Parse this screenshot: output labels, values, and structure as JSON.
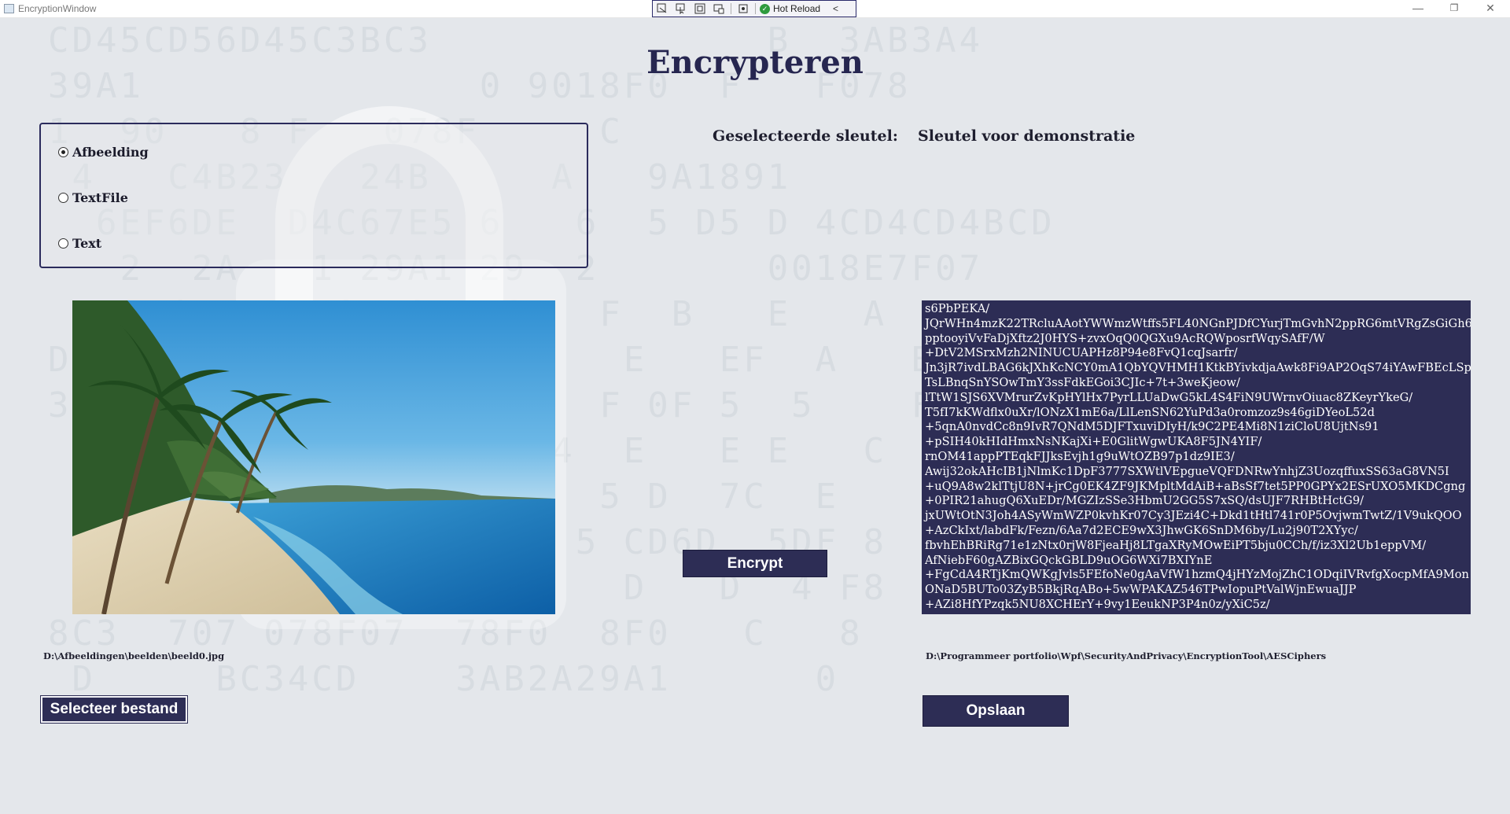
{
  "window": {
    "title": "EncryptionWindow",
    "minimize_glyph": "—",
    "restore_glyph": "❐",
    "close_glyph": "✕"
  },
  "debug_toolbar": {
    "hot_reload_label": "Hot Reload"
  },
  "page": {
    "title": "Encrypteren"
  },
  "input_type": {
    "options": [
      {
        "label": "Afbeelding",
        "selected": true
      },
      {
        "label": "TextFile",
        "selected": false
      },
      {
        "label": "Text",
        "selected": false
      }
    ]
  },
  "key": {
    "label": "Geselecteerde sleutel:",
    "value": "Sleutel voor demonstratie"
  },
  "image": {
    "path": "D:\\Afbeeldingen\\beelden\\beeld0.jpg",
    "select_label": "Selecteer bestand"
  },
  "encrypt": {
    "label": "Encrypt"
  },
  "output": {
    "cipher_lines": [
      "s6PbPEKA/",
      "JQrWHn4mzK22TRcluAAotYWWmzWtffs5FL40NGnPJDfCYurjTmGvhN2ppRG6mtVRgZsGiGh6",
      "pptooyiVvFaDjXftz2J0HYS+zvxOqQ0QGXu9AcRQWposrfWqySAfF/W",
      "+DtV2MSrxMzh2NINUCUAPHz8P94e8FvQ1cqJsarfr/",
      "Jn3jR7ivdLBAG6kJXhKcNCY0mA1QbYQVHMH1KtkBYivkdjaAwk8Fi9AP2OqS74iYAwFBEcLSp",
      "TsLBnqSnYSOwTmY3ssFdkEGoi3CJIc+7t+3weKjeow/",
      "lTtW1SJS6XVMrurZvKpHYlHx7PyrLLUaDwG5kL4S4FiN9UWrnvOiuac8ZKeyrYkeG/",
      "T5fI7kKWdflx0uXr/lONzX1mE6a/LlLenSN62YuPd3a0romzoz9s46giDYeoL52d",
      "+5qnA0nvdCc8n9IvR7QNdM5DJFTxuviDIyH/k9C2PE4Mi8N1ziCloU8UjtNs91",
      "+pSIH40kHIdHmxNsNKajXi+E0GlitWgwUKA8F5JN4YIF/",
      "rnOM41appPTEqkFJJksEvjh1g9uWtOZB97p1dz9IE3/",
      "Awij32okAHcIB1jNlmKc1DpF3777SXWtlVEpgueVQFDNRwYnhjZ3UozqffuxSS63aG8VN5I",
      "+uQ9A8w2klTtjU8N+jrCg0EK4ZF9JKMpltMdAiB+aBsSf7tet5PP0GPYx2ESrUXO5MKDCgng",
      "+0PIR21ahugQ6XuEDr/MGZIzSSe3HbmU2GG5S7xSQ/dsUJF7RHBtHctG9/",
      "jxUWtOtN3Joh4ASyWmWZP0kvhKr07Cy3JEzi4C+Dkd1tHtl741r0P5OvjwmTwtZ/1V9ukQOO",
      "+AzCkIxt/labdFk/Fezn/6Aa7d2ECE9wX3JhwGK6SnDM6by/Lu2j90T2XYyc/",
      "fbvhEhBRiRg71e1zNtx0rjW8FjeaHj8LTgaXRyMOwEiPT5bju0CCh/f/iz3Xl2Ub1eppVM/",
      "AfNiebF60gAZBixGQckGBLD9uOG6WXi7BXIYnE",
      "+FgCdA4RTjKmQWKgJvls5FEfoNe0gAaVfW1hzmQ4jHYzMojZhC1ODqiIVRvfgXocpMfA9Mon",
      "ONaD5BUTo03ZyB5BkjRqABo+5wWPAKAZ546TPwIopuPtValWjnEwuaJJP",
      "+AZi8HfYPzqk5NU8XCHErY+9vy1EeukNP3P4n0z/yXiC5z/"
    ],
    "path": "D:\\Programmeer portfolio\\Wpf\\SecurityAndPrivacy\\EncryptionTool\\AESCiphers",
    "save_label": "Opslaan"
  },
  "colors": {
    "accent": "#2d2d55",
    "background": "#e4e7eb"
  }
}
